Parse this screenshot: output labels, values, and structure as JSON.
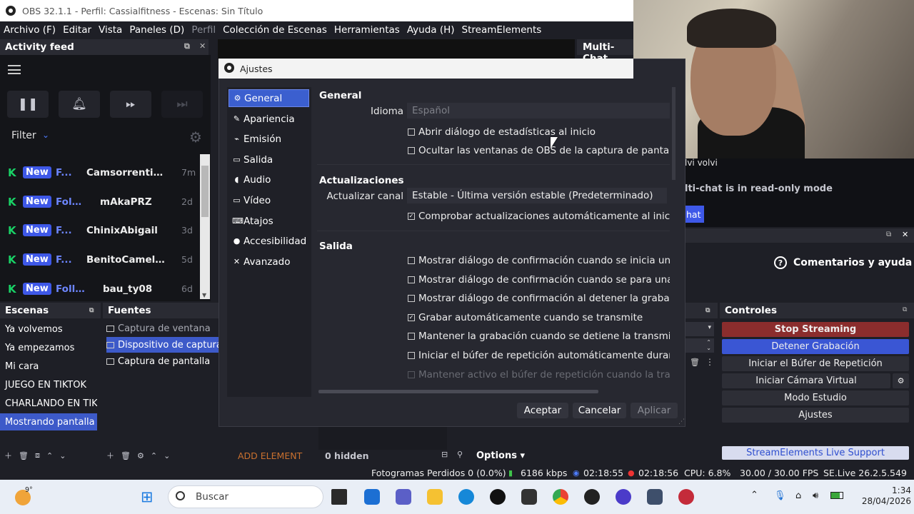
{
  "window": {
    "title": "OBS 32.1.1 - Perfil: Cassialfitness - Escenas: Sin Título"
  },
  "menu": [
    {
      "label": "Archivo (F)",
      "dim": false
    },
    {
      "label": "Editar",
      "dim": false
    },
    {
      "label": "Vista",
      "dim": false
    },
    {
      "label": "Paneles (D)",
      "dim": false
    },
    {
      "label": "Perfil",
      "dim": true
    },
    {
      "label": "Colección de Escenas",
      "dim": false
    },
    {
      "label": "Herramientas",
      "dim": false
    },
    {
      "label": "Ayuda (H)",
      "dim": false
    },
    {
      "label": "StreamElements",
      "dim": false
    }
  ],
  "activity_feed": {
    "title": "Activity feed",
    "filter_label": "Filter",
    "items": [
      {
        "badge": "New",
        "type": "F...",
        "user": "Camsorrentinojy",
        "time": "7m"
      },
      {
        "badge": "New",
        "type": "Foll...",
        "user": "mAkaPRZ",
        "time": "2d"
      },
      {
        "badge": "New",
        "type": "F...",
        "user": "ChinixAbigail",
        "time": "3d"
      },
      {
        "badge": "New",
        "type": "F...",
        "user": "BenitoCameloFC",
        "time": "5d"
      },
      {
        "badge": "New",
        "type": "Follo...",
        "user": "bau_ty08",
        "time": "6d"
      }
    ]
  },
  "chat": {
    "title": "Multi-Chat",
    "user_line": "lvi volvi",
    "readonly": "lti-chat is in read-only mode",
    "button": "hat"
  },
  "feedback": {
    "label": "Comentarios y ayuda"
  },
  "scenes": {
    "title": "Escenas",
    "items": [
      "Ya volvemos",
      "Ya empezamos",
      "Mi cara",
      "JUEGO EN TIKTOK",
      "CHARLANDO EN TIK",
      "Mostrando pantalla"
    ],
    "selected": 5
  },
  "sources": {
    "title": "Fuentes",
    "items": [
      {
        "label": "Captura de ventana",
        "state": "dim"
      },
      {
        "label": "Dispositivo de captura",
        "state": "sel"
      },
      {
        "label": "Captura de pantalla",
        "state": "normal"
      }
    ]
  },
  "source_bar": {
    "add_element": "ADD ELEMENT",
    "hidden": "0 hidden",
    "options": "Options"
  },
  "controls": {
    "title": "Controles",
    "buttons": [
      {
        "label": "Stop Streaming",
        "style": "stop"
      },
      {
        "label": "Detener Grabación",
        "style": "rec"
      },
      {
        "label": "Iniciar el Búfer de Repetición",
        "style": "normal"
      },
      {
        "label": "Iniciar Cámara Virtual",
        "style": "normal"
      },
      {
        "label": "Modo Estudio",
        "style": "normal"
      },
      {
        "label": "Ajustes",
        "style": "normal"
      }
    ],
    "support": "StreamElements Live Support"
  },
  "settings": {
    "title": "Ajustes",
    "categories": [
      {
        "label": "General",
        "icon": "gear-icon"
      },
      {
        "label": "Apariencia",
        "icon": "palette-icon"
      },
      {
        "label": "Emisión",
        "icon": "antenna-icon"
      },
      {
        "label": "Salida",
        "icon": "output-icon"
      },
      {
        "label": "Audio",
        "icon": "speaker-icon"
      },
      {
        "label": "Vídeo",
        "icon": "monitor-icon"
      },
      {
        "label": "Atajos",
        "icon": "keyboard-icon"
      },
      {
        "label": "Accesibilidad",
        "icon": "accessibility-icon"
      },
      {
        "label": "Avanzado",
        "icon": "wrench-icon"
      }
    ],
    "selected_category": 0,
    "general": {
      "heading": "General",
      "language_label": "Idioma",
      "language_value": "Español",
      "checks": [
        {
          "label": "Abrir diálogo de estadísticas al inicio",
          "checked": false
        },
        {
          "label": "Ocultar las ventanas de OBS de la captura de pantalla",
          "checked": false
        }
      ]
    },
    "updates": {
      "heading": "Actualizaciones",
      "channel_label": "Actualizar canal",
      "channel_value": "Estable - Última versión estable (Predeterminado)",
      "auto_check": {
        "label": "Comprobar actualizaciones automáticamente al inicio",
        "checked": true
      }
    },
    "output": {
      "heading": "Salida",
      "checks": [
        {
          "label": "Mostrar diálogo de confirmación cuando se inicia una transmisión",
          "checked": false,
          "disabled": false
        },
        {
          "label": "Mostrar diálogo de confirmación cuando se para una transmisión",
          "checked": false,
          "disabled": false
        },
        {
          "label": "Mostrar diálogo de confirmación al detener la grabación",
          "checked": false,
          "disabled": false
        },
        {
          "label": "Grabar automáticamente cuando se transmite",
          "checked": true,
          "disabled": false
        },
        {
          "label": "Mantener la grabación cuando se detiene la transmisión",
          "checked": false,
          "disabled": false
        },
        {
          "label": "Iniciar el búfer de repetición automáticamente durante la grabación",
          "checked": false,
          "disabled": false
        },
        {
          "label": "Mantener activo el búfer de repetición cuando la transmisión se detiene",
          "checked": false,
          "disabled": true
        }
      ]
    },
    "buttons": {
      "accept": "Aceptar",
      "cancel": "Cancelar",
      "apply": "Aplicar"
    }
  },
  "status": {
    "dropped_frames": "Fotogramas Perdidos 0 (0.0%)",
    "bitrate": "6186 kbps",
    "stream_time": "02:18:55",
    "rec_time": "02:18:56",
    "cpu": "CPU: 6.8%",
    "fps": "30.00 / 30.00 FPS",
    "plugin": "SE.Live 26.2.5.549"
  },
  "taskbar": {
    "weather": "9°",
    "search_placeholder": "Buscar",
    "time": "1:34",
    "date": "28/04/2026"
  },
  "colors": {
    "accent": "#3d5ac9",
    "stop": "#8b2d2d",
    "rec": "#3a56d4",
    "kick": "#19d266"
  }
}
